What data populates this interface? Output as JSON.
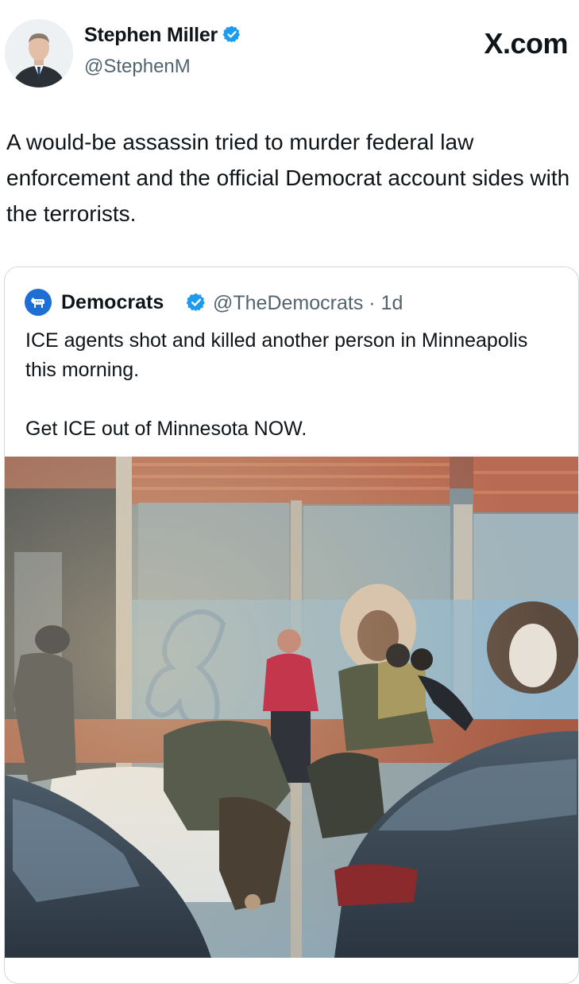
{
  "author": {
    "name": "Stephen Miller",
    "handle": "@StephenM",
    "verified": true,
    "avatar_icon": "person-portrait-icon"
  },
  "site_logo": "X.com",
  "post": {
    "text": "A would-be assassin tried to murder federal law enforcement and the official Democrat account sides with the terrorists."
  },
  "quoted_post": {
    "name": "Democrats",
    "handle_time": "@TheDemocrats · 1d",
    "verified": true,
    "avatar_icon": "donkey-logo-icon",
    "text_line1": "ICE agents shot and killed another person in Minneapolis this morning.",
    "text_line2": "Get ICE out of Minnesota NOW.",
    "media_icon": "street-scene-video-thumbnail"
  },
  "colors": {
    "verified_badge": "#1d9bf0",
    "democrats_blue": "#1d6fd6",
    "text_primary": "#0f1419",
    "text_secondary": "#536471",
    "card_border": "#cfd9de"
  }
}
